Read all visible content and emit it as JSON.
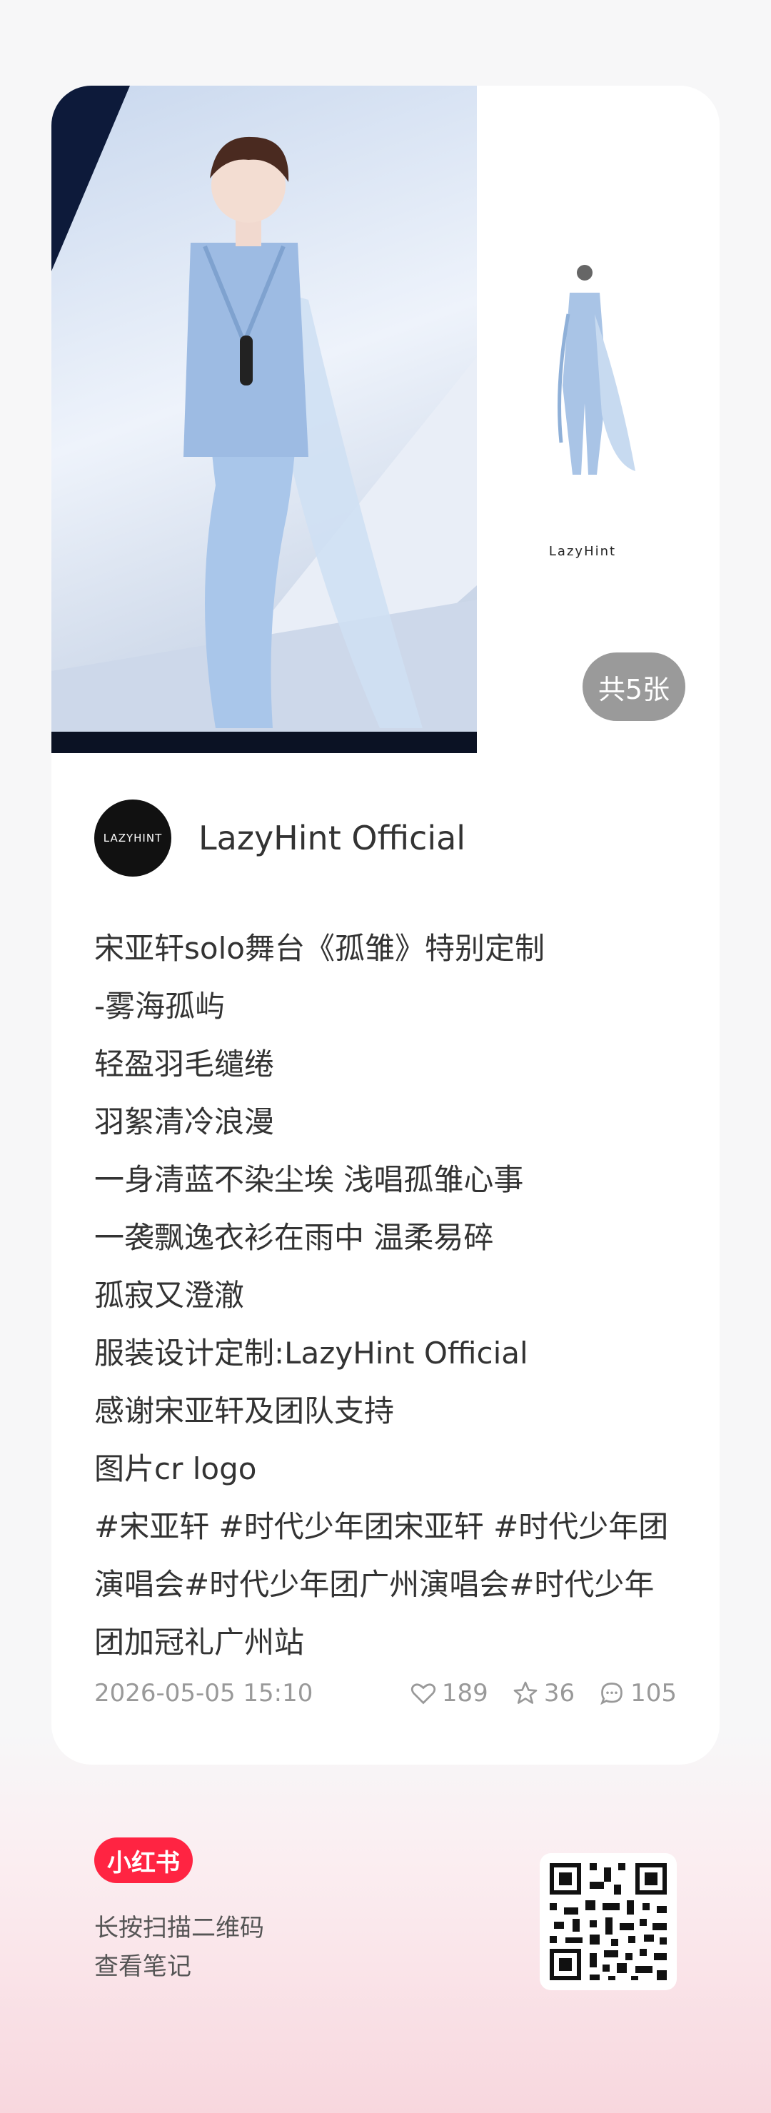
{
  "post": {
    "image_count": "共5张",
    "sketch_watermark": "LazyHint",
    "author": {
      "avatar_text": "LAZYHINT",
      "name": "LazyHint Official"
    },
    "lines": [
      "宋亚轩solo舞台《孤雏》特别定制",
      "-雾海孤屿",
      "轻盈羽毛缱绻",
      "羽絮清冷浪漫",
      "一身清蓝不染尘埃 浅唱孤雏心事",
      "一袭飘逸衣衫在雨中 温柔易碎",
      "孤寂又澄澈",
      "服装设计定制:LazyHint Official",
      "感谢宋亚轩及团队支持",
      "图片cr logo"
    ],
    "tags": "#宋亚轩 #时代少年团宋亚轩 #时代少年团演唱会#时代少年团广州演唱会#时代少年团加冠礼广州站",
    "timestamp": "2026-05-05 15:10",
    "likes": "189",
    "stars": "36",
    "comments": "105"
  },
  "footer": {
    "brand": "小红书",
    "hint_line1": "长按扫描二维码",
    "hint_line2": "查看笔记"
  },
  "colors": {
    "brand_red": "#ff2442",
    "card_bg": "#ffffff"
  },
  "icons": {
    "like": "heart-icon",
    "star": "star-icon",
    "comment": "comment-icon"
  }
}
